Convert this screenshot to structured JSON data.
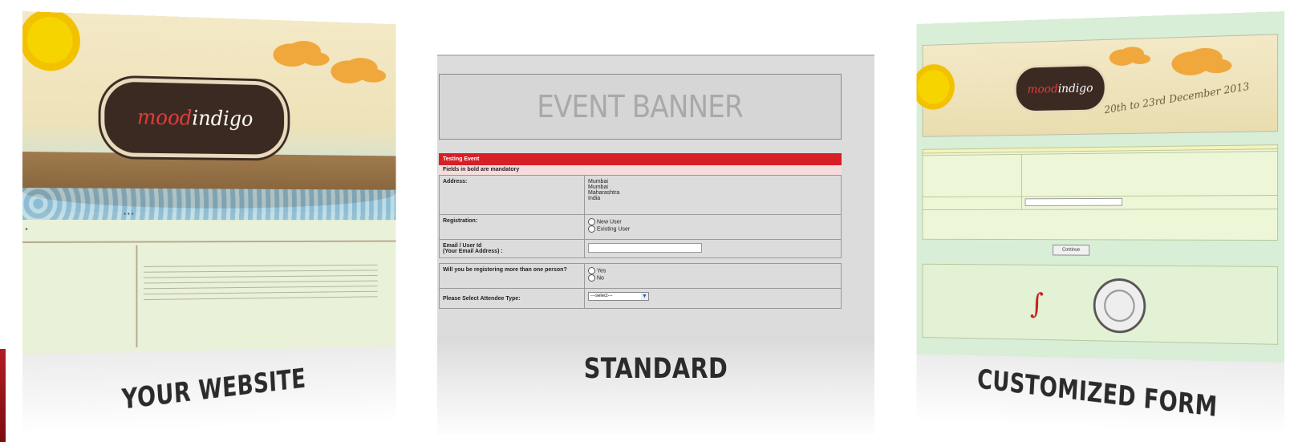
{
  "panels": {
    "website": {
      "caption": "YOUR WEBSITE",
      "logo_part1": "mood",
      "logo_part2": "indigo"
    },
    "standard": {
      "caption": "STANDARD",
      "banner_text": "EVENT BANNER",
      "form": {
        "header": "Testing Event",
        "note": "Fields in bold are mandatory",
        "address_label": "Address:",
        "address_lines": [
          "Mumbai",
          "Mumbai",
          "Maharashtra",
          "India"
        ],
        "registration_label": "Registration:",
        "registration_options": [
          "New User",
          "Existing User"
        ],
        "email_label": "Email / User Id",
        "email_sublabel": "(Your Email Address) :",
        "multi_label": "Will you be registering more than one person?",
        "multi_options": [
          "Yes",
          "No"
        ],
        "attendee_label": "Please Select Attendee Type:",
        "attendee_select": "---select---"
      }
    },
    "customized": {
      "caption": "CUSTOMIZED FORM",
      "logo_part1": "mood",
      "logo_part2": "indigo",
      "dates_text": "20th to 23rd December 2013",
      "continue_button": "Continue"
    }
  },
  "colors": {
    "accent_red": "#d71f26",
    "form_green": "#d8eed6",
    "caption_text": "#2b2b2b"
  }
}
